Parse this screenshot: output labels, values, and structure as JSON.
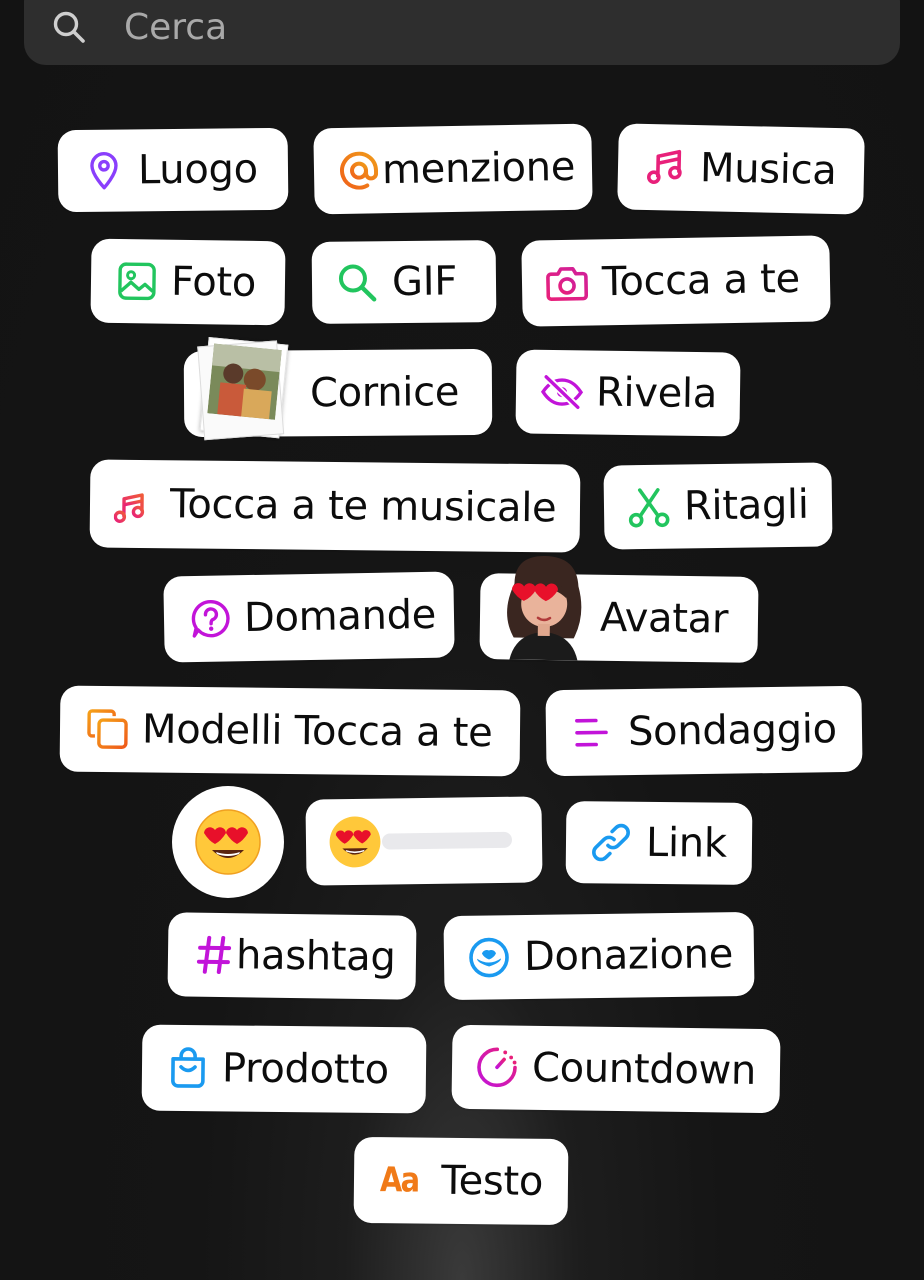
{
  "search": {
    "placeholder": "Cerca"
  },
  "stickers": {
    "luogo": "Luogo",
    "menzione": "menzione",
    "musica": "Musica",
    "foto": "Foto",
    "gif": "GIF",
    "tocca": "Tocca a te",
    "cornice": "Cornice",
    "rivela": "Rivela",
    "tocca_musicale": "Tocca a te musicale",
    "ritagli": "Ritagli",
    "domande": "Domande",
    "avatar": "Avatar",
    "modelli": "Modelli Tocca a te",
    "sondaggio": "Sondaggio",
    "link": "Link",
    "hashtag": "hashtag",
    "donazione": "Donazione",
    "prodotto": "Prodotto",
    "countdown": "Countdown",
    "testo": "Testo",
    "testo_icon": "Aa"
  },
  "icons": {
    "luogo": "map-pin-icon",
    "menzione": "at-sign-icon",
    "musica": "music-note-icon",
    "foto": "photo-icon",
    "gif": "search-icon",
    "tocca": "camera-icon",
    "rivela": "eye-off-icon",
    "tocca_musicale": "music-plus-icon",
    "ritagli": "scissors-icon",
    "domande": "question-bubble-icon",
    "modelli": "template-add-icon",
    "sondaggio": "poll-lines-icon",
    "link": "link-icon",
    "hashtag": "hash-icon",
    "donazione": "donation-icon",
    "prodotto": "shopping-bag-icon",
    "countdown": "timer-icon",
    "testo": "text-icon"
  },
  "colors": {
    "purple": "#8a3ffc",
    "pink": "#e8207a",
    "magenta": "#c214d9",
    "green": "#22c55e",
    "blue": "#1a9af0",
    "orange": "#f07a18"
  },
  "slider": {
    "value": 0.0
  }
}
